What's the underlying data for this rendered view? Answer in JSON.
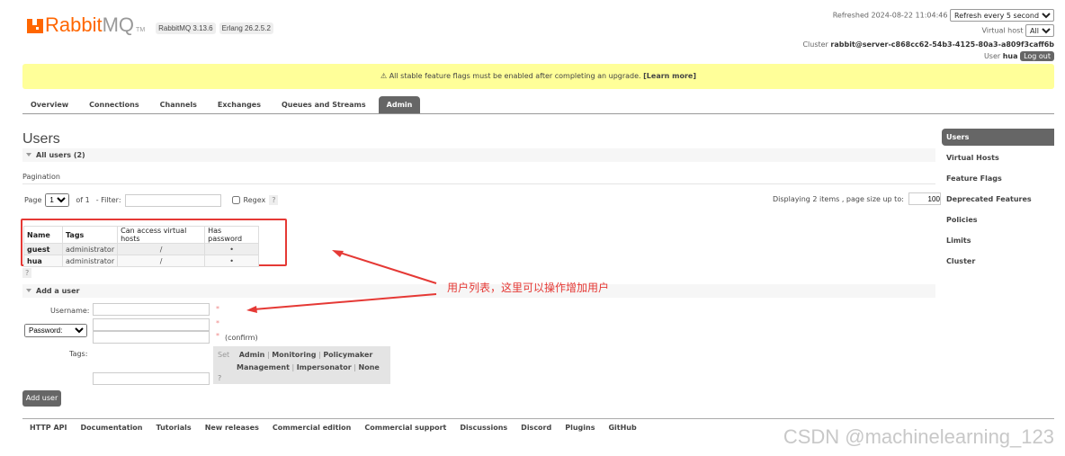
{
  "header": {
    "logo_text": "RabbitMQ",
    "logo_tm": "TM",
    "version": "RabbitMQ 3.13.6",
    "erlang": "Erlang 26.2.5.2",
    "refreshed_label": "Refreshed 2024-08-22 11:04:46",
    "refresh_select": "Refresh every 5 seconds",
    "vhost_label": "Virtual host",
    "vhost_select": "All",
    "cluster_label": "Cluster",
    "cluster_name": "rabbit@server-c868cc62-54b3-4125-80a3-a809f3caff6b",
    "user_label": "User",
    "user_name": "hua",
    "logout": "Log out"
  },
  "banner": {
    "text": "⚠ All stable feature flags must be enabled after completing an upgrade.",
    "link": "[Learn more]"
  },
  "tabs": [
    "Overview",
    "Connections",
    "Channels",
    "Exchanges",
    "Queues and Streams",
    "Admin"
  ],
  "page_title": "Users",
  "all_users": {
    "title": "All users (2)",
    "pagination_label": "Pagination",
    "page_label": "Page",
    "page_value": "1",
    "of_label": "of 1",
    "filter_label": "- Filter:",
    "regex_label": "Regex",
    "help": "?",
    "displaying": "Displaying 2 items , page size up to:",
    "page_size": "100",
    "columns": [
      "Name",
      "Tags",
      "Can access virtual hosts",
      "Has password"
    ],
    "rows": [
      [
        "guest",
        "administrator",
        "/",
        "•"
      ],
      [
        "hua",
        "administrator",
        "/",
        "•"
      ]
    ]
  },
  "add_user": {
    "title": "Add a user",
    "username_label": "Username:",
    "password_select": "Password:",
    "required": "*",
    "confirm": "(confirm)",
    "tags_label": "Tags:",
    "set_label": "Set",
    "tags_row1": [
      "Admin",
      "Monitoring",
      "Policymaker"
    ],
    "tags_row2": [
      "Management",
      "Impersonator",
      "None"
    ],
    "sep": "|",
    "help": "?",
    "button": "Add user"
  },
  "sidebar": [
    "Users",
    "Virtual Hosts",
    "Feature Flags",
    "Deprecated Features",
    "Policies",
    "Limits",
    "Cluster"
  ],
  "footer": [
    "HTTP API",
    "Documentation",
    "Tutorials",
    "New releases",
    "Commercial edition",
    "Commercial support",
    "Discussions",
    "Discord",
    "Plugins",
    "GitHub"
  ],
  "annotation": "用户列表，这里可以操作增加用户",
  "watermark": "CSDN @machinelearning_123",
  "colors": {
    "brand": "#ff6600",
    "banner": "#ffff99",
    "active": "#666666",
    "annotation": "#e53935"
  }
}
